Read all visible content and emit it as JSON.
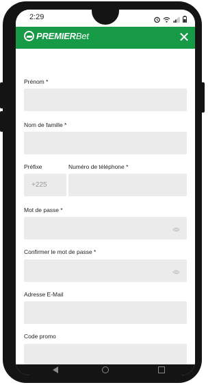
{
  "status_bar": {
    "time": "2:29",
    "icons": [
      "alarm-icon",
      "wifi-icon",
      "signal-icon",
      "battery-icon"
    ]
  },
  "header": {
    "brand_bold": "PREMIER",
    "brand_light": "Bet",
    "close_label": "✕",
    "accent_color": "#169a46"
  },
  "form": {
    "first_name_label": "Prénom *",
    "last_name_label": "Nom de famille *",
    "prefix_label": "Préfixe",
    "prefix_value": "+225",
    "phone_label": "Numéro de téléphone *",
    "password_label": "Mot de passe *",
    "confirm_password_label": "Confirmer le mot de passe *",
    "email_label": "Adresse E-Mail",
    "promo_label": "Code promo"
  },
  "navbar": {
    "icons": [
      "back-icon",
      "home-icon",
      "recent-apps-icon"
    ]
  }
}
